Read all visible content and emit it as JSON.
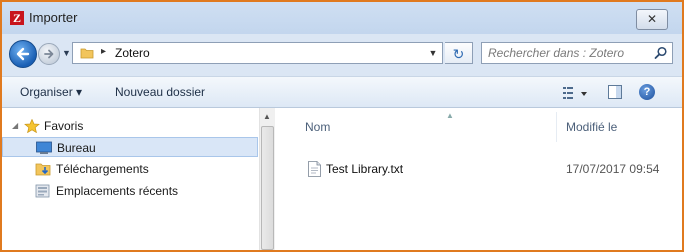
{
  "window": {
    "title": "Importer",
    "close_glyph": "✕"
  },
  "address": {
    "path": "Zotero",
    "separator": "▸",
    "dropdown_glyph": "▼"
  },
  "refresh": {
    "glyph": "↻"
  },
  "search": {
    "placeholder": "Rechercher dans : Zotero"
  },
  "toolbar": {
    "organiser_label": "Organiser ▾",
    "new_folder_label": "Nouveau dossier",
    "help_glyph": "?"
  },
  "nav_pane": {
    "favorites_label": "Favoris",
    "items": [
      {
        "label": "Bureau",
        "icon": "desktop-icon",
        "selected": true
      },
      {
        "label": "Téléchargements",
        "icon": "downloads-folder-icon",
        "selected": false
      },
      {
        "label": "Emplacements récents",
        "icon": "recent-places-icon",
        "selected": false
      }
    ]
  },
  "file_list": {
    "columns": [
      "Nom",
      "Modifié le"
    ],
    "rows": [
      {
        "name": "Test Library.txt",
        "modified": "17/07/2017 09:54",
        "icon": "text-file-icon"
      }
    ]
  },
  "colors": {
    "accent_border": "#e07a1f",
    "chrome": "#dbe6f4",
    "selection": "#d9e6f7",
    "app_icon": "#c8141c"
  }
}
